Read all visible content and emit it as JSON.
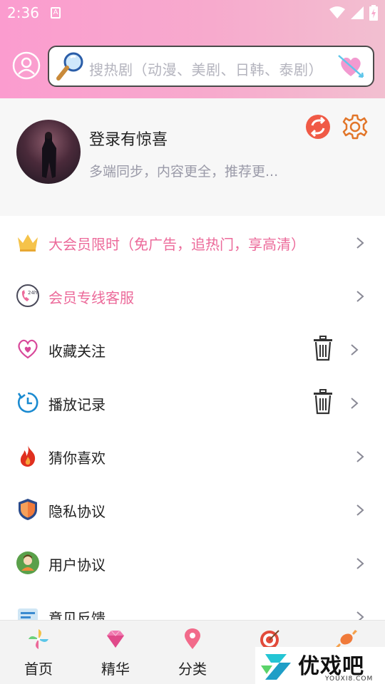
{
  "status_bar": {
    "time": "2:36",
    "notification_icon": "A"
  },
  "search": {
    "placeholder": "搜热剧（动漫、美剧、日韩、泰剧）"
  },
  "profile": {
    "title": "登录有惊喜",
    "subtitle": "多端同步，内容更全，推荐更..."
  },
  "menu": [
    {
      "label": "大会员限时（免广告，追热门，享高清）",
      "icon": "crown-icon",
      "highlight": true,
      "trash": false
    },
    {
      "label": "会员专线客服",
      "icon": "support-24h-icon",
      "highlight": true,
      "trash": false
    },
    {
      "label": "收藏关注",
      "icon": "heart-outline-icon",
      "highlight": false,
      "trash": true
    },
    {
      "label": "播放记录",
      "icon": "history-clock-icon",
      "highlight": false,
      "trash": true
    },
    {
      "label": "猜你喜欢",
      "icon": "fire-icon",
      "highlight": false,
      "trash": false
    },
    {
      "label": "隐私协议",
      "icon": "shield-icon",
      "highlight": false,
      "trash": false
    },
    {
      "label": "用户协议",
      "icon": "user-badge-icon",
      "highlight": false,
      "trash": false
    },
    {
      "label": "意见反馈",
      "icon": "feedback-icon",
      "highlight": false,
      "trash": false
    }
  ],
  "tabs": [
    {
      "label": "首页",
      "icon": "pinwheel-icon"
    },
    {
      "label": "精华",
      "icon": "diamond-icon"
    },
    {
      "label": "分类",
      "icon": "location-pin-icon"
    },
    {
      "label": "",
      "icon": "target-icon"
    },
    {
      "label": "",
      "icon": "candy-icon"
    }
  ],
  "watermark": {
    "title": "优戏吧",
    "subtitle": "YOUXI8.COM"
  },
  "colors": {
    "header_start": "#fb9ccf",
    "header_end": "#f2bfd0",
    "accent_pink": "#ec6a9a"
  }
}
